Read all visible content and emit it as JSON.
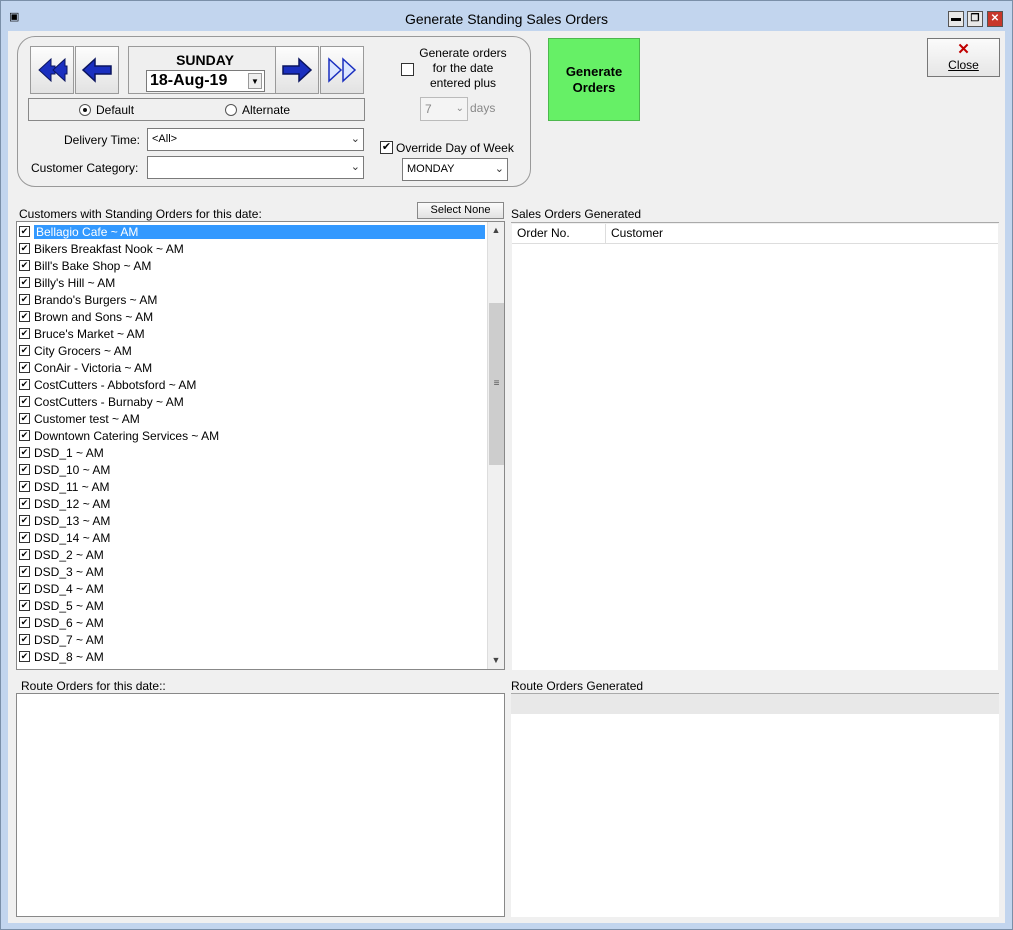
{
  "window": {
    "title": "Generate Standing Sales Orders",
    "min": "▬",
    "max": "❐",
    "close": "✕"
  },
  "date_panel": {
    "day": "SUNDAY",
    "date": "18-Aug-19",
    "radio_default": "Default",
    "radio_alternate": "Alternate",
    "delivery_time_label": "Delivery Time:",
    "delivery_time_value": "<All>",
    "customer_category_label": "Customer Category:",
    "customer_category_value": "",
    "generate_plus_label": "Generate orders for the date entered plus",
    "plus_days_value": "7",
    "days_label": "days",
    "override_label": "Override Day of Week",
    "override_value": "MONDAY"
  },
  "actions": {
    "generate": "Generate Orders",
    "close": "Close",
    "select_none": "Select None"
  },
  "customers": {
    "label": "Customers with Standing Orders for this date:",
    "items": [
      "Bellagio Cafe ~ AM",
      "Bikers Breakfast Nook ~ AM",
      "Bill's Bake Shop ~ AM",
      "Billy's Hill ~ AM",
      "Brando's Burgers ~ AM",
      "Brown and Sons ~ AM",
      "Bruce's Market ~ AM",
      "City Grocers ~ AM",
      "ConAir - Victoria ~ AM",
      "CostCutters - Abbotsford ~ AM",
      "CostCutters - Burnaby ~ AM",
      "Customer test ~ AM",
      "Downtown Catering Services ~ AM",
      "DSD_1 ~ AM",
      "DSD_10 ~ AM",
      "DSD_11 ~ AM",
      "DSD_12 ~ AM",
      "DSD_13 ~ AM",
      "DSD_14 ~ AM",
      "DSD_2 ~ AM",
      "DSD_3 ~ AM",
      "DSD_4 ~ AM",
      "DSD_5 ~ AM",
      "DSD_6 ~ AM",
      "DSD_7 ~ AM",
      "DSD_8 ~ AM"
    ]
  },
  "sales_orders": {
    "label": "Sales Orders Generated",
    "col_order": "Order No.",
    "col_customer": "Customer"
  },
  "route_orders": {
    "label": "Route Orders for this date::"
  },
  "route_generated": {
    "label": "Route Orders Generated"
  }
}
